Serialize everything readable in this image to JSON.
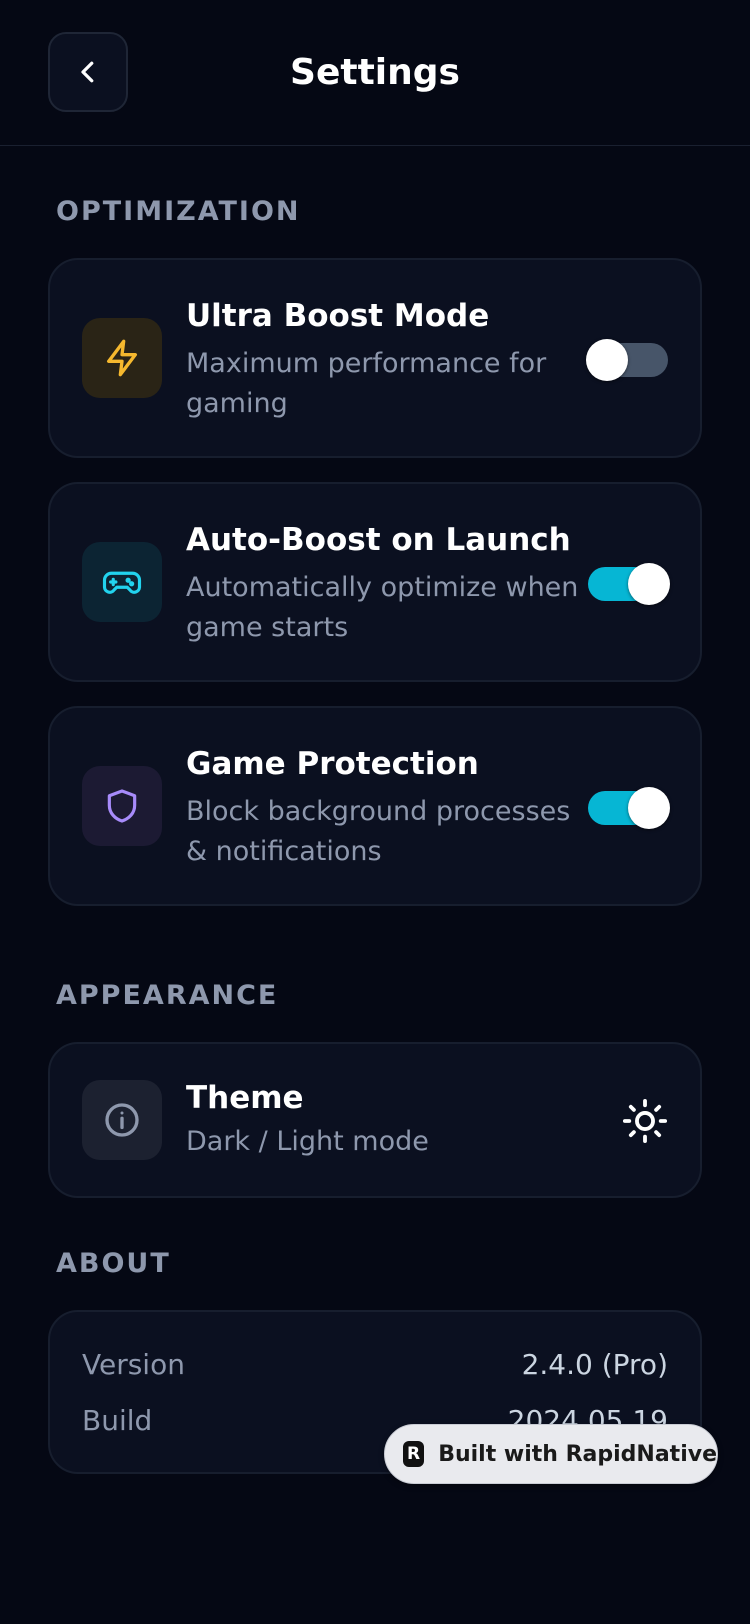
{
  "header": {
    "title": "Settings",
    "back_icon": "chevron-left-icon"
  },
  "sections": {
    "optimization": {
      "label": "OPTIMIZATION",
      "items": [
        {
          "title": "Ultra Boost Mode",
          "description": "Maximum performance for gaming",
          "icon": "lightning-icon",
          "icon_color": "#f5b82e",
          "icon_bg": "#2a2416",
          "enabled": false
        },
        {
          "title": "Auto-Boost on Launch",
          "description": "Automatically optimize when game starts",
          "icon": "gamepad-icon",
          "icon_color": "#22d3ee",
          "icon_bg": "#0c2433",
          "enabled": true
        },
        {
          "title": "Game Protection",
          "description": "Block background processes & notifications",
          "icon": "shield-icon",
          "icon_color": "#a78bfa",
          "icon_bg": "#1c1a33",
          "enabled": true
        }
      ]
    },
    "appearance": {
      "label": "APPEARANCE",
      "theme": {
        "title": "Theme",
        "description": "Dark / Light mode",
        "icon": "info-icon",
        "action_icon": "sun-icon"
      }
    },
    "about": {
      "label": "ABOUT",
      "rows": [
        {
          "label": "Version",
          "value": "2.4.0 (Pro)"
        },
        {
          "label": "Build",
          "value": "2024.05.19"
        }
      ]
    }
  },
  "badge": {
    "text": "Built with RapidNative",
    "logo_letter": "R"
  },
  "colors": {
    "background": "#050814",
    "card": "#0b1020",
    "accent": "#06b6d4",
    "toggle_off": "#475569",
    "muted_text": "#8e98ad"
  }
}
